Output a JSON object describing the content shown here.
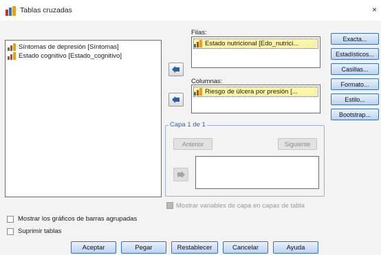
{
  "window": {
    "title": "Tablas cruzadas",
    "close_glyph": "×"
  },
  "source_list": {
    "items": [
      {
        "label": "Síntomas de depresión [Síntomas]"
      },
      {
        "label": "Estado cognitivo  [Estado_cognitivo]"
      }
    ]
  },
  "rows": {
    "label": "Filas:",
    "item": "Estado nutricional  [Edo_nutrici..."
  },
  "columns": {
    "label": "Columnas:",
    "item": "Riesgo de úlcera por presión [..."
  },
  "layer": {
    "title": "Capa 1 de 1",
    "previous": "Anterior",
    "next": "Siguiente",
    "show_layers_label": "Mostrar variables de capa en capas de tabla"
  },
  "side_buttons": [
    "Exacta...",
    "Estadísticos...",
    "Casillas...",
    "Formato...",
    "Estilo...",
    "Bootstrap..."
  ],
  "options": {
    "clustered_bars": "Mostrar los gráficos de barras agrupadas",
    "suppress_tables": "Suprimir tablas"
  },
  "footer_buttons": [
    "Aceptar",
    "Pegar",
    "Restablecer",
    "Cancelar",
    "Ayuda"
  ],
  "colors": {
    "accent": "#3b6fb8",
    "selection": "#fff6a8",
    "group_title": "#3366aa"
  },
  "icons": {
    "app": "spss-crosstabs-icon",
    "variable": "ordinal-bar-chart-icon",
    "arrow": "arrow-left-icon"
  }
}
